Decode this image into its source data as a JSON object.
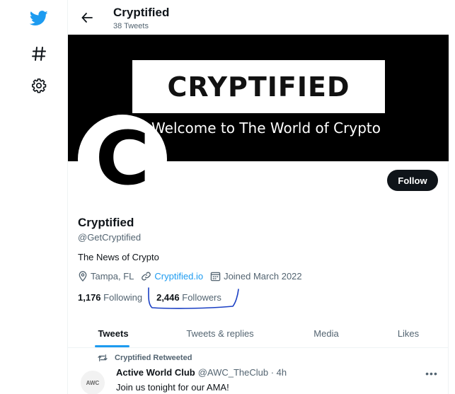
{
  "nav": {
    "items": [
      {
        "icon": "twitter-bird-icon"
      },
      {
        "icon": "hashtag-icon"
      },
      {
        "icon": "gear-icon"
      }
    ]
  },
  "header": {
    "name": "Cryptified",
    "tweet_count": "38 Tweets"
  },
  "banner": {
    "title": "CRYPTIFIED",
    "subtitle": "Welcome to The World of Crypto"
  },
  "avatar": {
    "letter": "C"
  },
  "profile": {
    "follow_label": "Follow",
    "name": "Cryptified",
    "handle": "@GetCryptified",
    "bio": "The News of Crypto",
    "location": "Tampa, FL",
    "website": "Cryptified.io",
    "joined": "Joined March 2022",
    "following_count": "1,176",
    "following_label": "Following",
    "followers_count": "2,446",
    "followers_label": "Followers"
  },
  "tabs": [
    {
      "label": "Tweets",
      "active": true
    },
    {
      "label": "Tweets & replies",
      "active": false
    },
    {
      "label": "Media",
      "active": false
    },
    {
      "label": "Likes",
      "active": false
    }
  ],
  "tweet": {
    "retweet_label": "Cryptified Retweeted",
    "author": "Active World Club",
    "meta": "@AWC_TheClub · 4h",
    "text": "Join us tonight for our AMA!",
    "avatar_text": "AWC"
  },
  "colors": {
    "accent": "#1d9bf0",
    "text": "#0f1419",
    "muted": "#536471",
    "scribble": "#1a3fc4"
  }
}
